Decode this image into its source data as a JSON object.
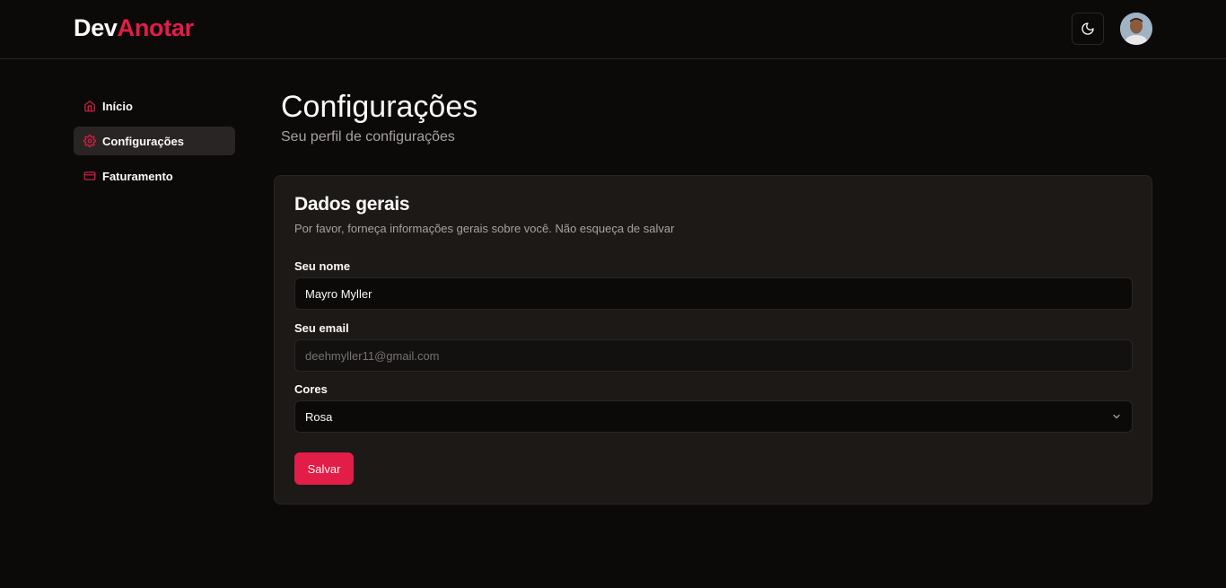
{
  "brand": {
    "part1": "Dev",
    "part2": "Anotar",
    "accent_color": "#e11d48"
  },
  "header": {
    "theme_toggle_icon": "moon-icon",
    "avatar_icon": "user-avatar"
  },
  "sidebar": {
    "items": [
      {
        "label": "Início",
        "icon": "home-icon",
        "active": false
      },
      {
        "label": "Configurações",
        "icon": "gear-icon",
        "active": true
      },
      {
        "label": "Faturamento",
        "icon": "credit-card-icon",
        "active": false
      }
    ]
  },
  "page": {
    "title": "Configurações",
    "subtitle": "Seu perfil de configurações"
  },
  "card": {
    "title": "Dados gerais",
    "description": "Por favor, forneça informações gerais sobre você. Não esqueça de salvar",
    "name": {
      "label": "Seu nome",
      "value": "Mayro Myller"
    },
    "email": {
      "label": "Seu email",
      "value": "deehmyller11@gmail.com"
    },
    "color": {
      "label": "Cores",
      "selected": "Rosa"
    },
    "save_label": "Salvar"
  }
}
